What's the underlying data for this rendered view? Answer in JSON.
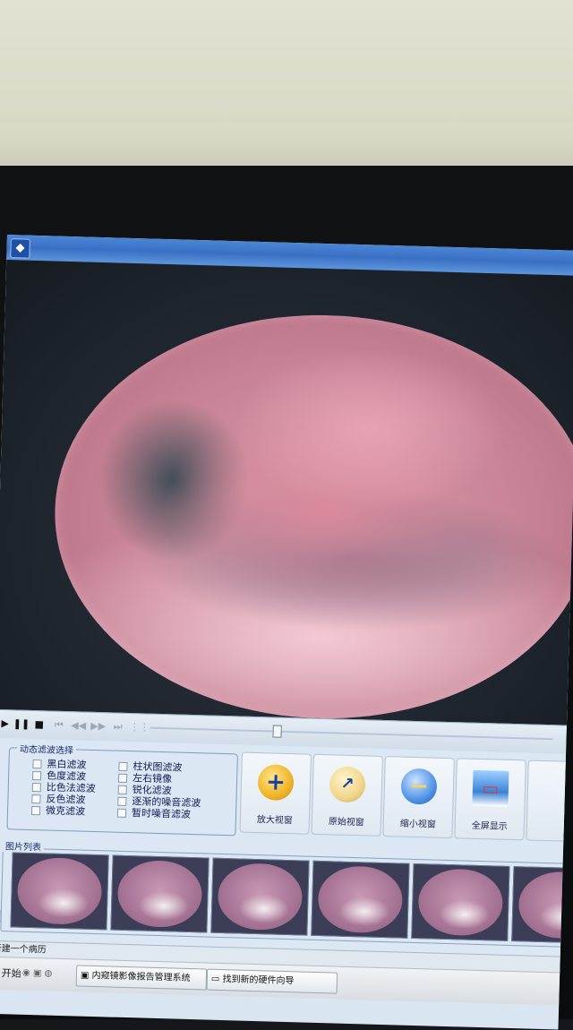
{
  "filters": {
    "legend": "动态滤波选择",
    "left": [
      "黑白滤波",
      "色度滤波",
      "比色法滤波",
      "反色滤波",
      "微克滤波"
    ],
    "right": [
      "柱状图滤波",
      "左右镜像",
      "锐化滤波",
      "逐渐的噪音滤波",
      "暂时噪音滤波"
    ]
  },
  "tools": [
    {
      "label": "放大视窗",
      "icon": "zoom-in-icon",
      "glyph": "+"
    },
    {
      "label": "原始视窗",
      "icon": "original-view-icon",
      "glyph": "↗"
    },
    {
      "label": "缩小视窗",
      "icon": "zoom-out-icon",
      "glyph": "−"
    },
    {
      "label": "全屏显示",
      "icon": "fullscreen-icon",
      "glyph": "▭"
    }
  ],
  "thumbnails": {
    "legend": "图片列表",
    "count": 6
  },
  "status": {
    "text": "新建一个病历"
  },
  "taskbar": {
    "start": "开始",
    "items": [
      "内窥镜影像报告管理系统",
      "找到新的硬件向导"
    ]
  }
}
